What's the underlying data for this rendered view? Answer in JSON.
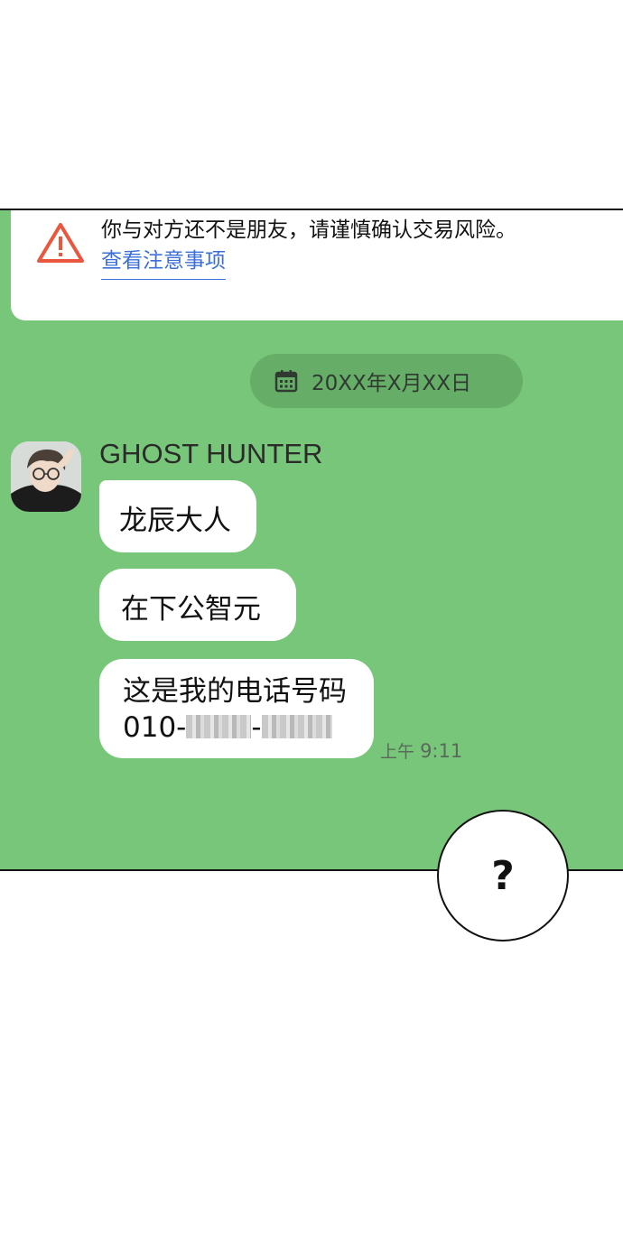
{
  "warning": {
    "text": "你与对方还不是朋友，请谨慎确认交易风险。",
    "link": "查看注意事项",
    "icon": "warning-triangle-icon",
    "accent": "#e9573f"
  },
  "date_pill": {
    "icon": "calendar-icon",
    "text": "20XX年X月XX日"
  },
  "chat": {
    "sender": "GHOST HUNTER",
    "avatar_icon": "avatar",
    "messages": [
      {
        "text": "龙辰大人"
      },
      {
        "text": "在下公智元"
      },
      {
        "line1": "这是我的电话号码",
        "prefix": "010-",
        "separator": "-"
      }
    ],
    "time": {
      "period": "上午",
      "clock": "9:11"
    }
  },
  "overlay": {
    "symbol": "?"
  },
  "colors": {
    "panel_bg": "#78c679",
    "bubble_bg": "#ffffff",
    "link": "#3c6fd8"
  }
}
